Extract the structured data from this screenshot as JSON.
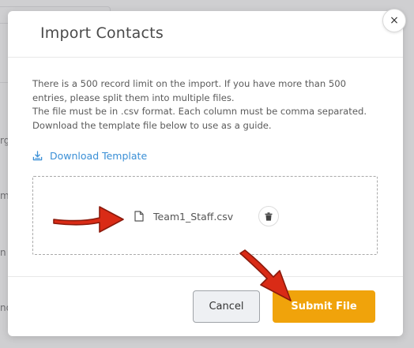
{
  "background": {
    "fragments": [
      "rg",
      "m",
      "n",
      "nd"
    ]
  },
  "modal": {
    "title": "Import Contacts",
    "close_glyph": "×",
    "info_lines": [
      "There is a 500 record limit on the import. If you have more than 500",
      "entries, please split them into multiple files.",
      "The file must be in .csv format. Each column must be comma separated.",
      "Download the template file below to use as a guide."
    ],
    "download_label": "Download Template",
    "file": {
      "name": "Team1_Staff.csv",
      "icon": "file-icon"
    },
    "footer": {
      "cancel_label": "Cancel",
      "submit_label": "Submit File"
    }
  },
  "colors": {
    "accent": "#f0a30b",
    "link": "#3a8fd6",
    "arrow": "#d92b16"
  }
}
